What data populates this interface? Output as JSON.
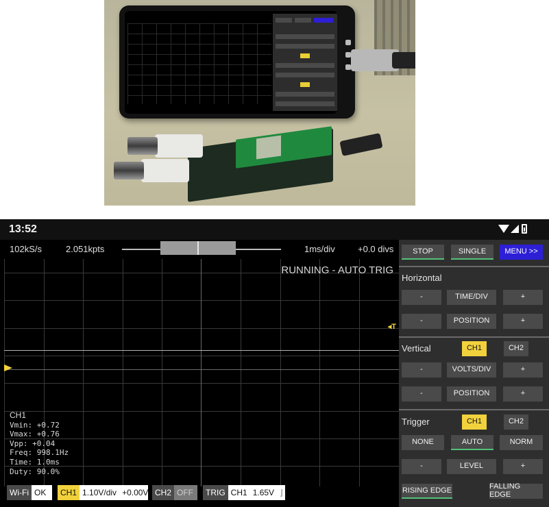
{
  "status_bar": {
    "time": "13:52"
  },
  "scope": {
    "sample_rate": "102kS/s",
    "points": "2.051kpts",
    "timebase": "1ms/div",
    "offset": "+0.0 divs",
    "run_state": "RUNNING - AUTO TRIG",
    "trigger_marker": "◂T",
    "measurements": {
      "channel": "CH1",
      "lines": [
        "Vmin: +0.72",
        "Vmax: +0.76",
        "Vpp: +0.04",
        "Freq: 998.1Hz",
        "Time: 1.0ms",
        "Duty: 90.0%"
      ]
    },
    "bottom_bar": {
      "wifi_tag": "Wi-Fi",
      "wifi_val": "OK",
      "ch1_tag": "CH1",
      "ch1_scale": "1.10V/div",
      "ch1_offset": "+0.00V",
      "ch2_tag": "CH2",
      "ch2_val": "OFF",
      "trig_tag": "TRIG",
      "trig_src": "CH1",
      "trig_level": "1.65V",
      "trig_edge": "⌋"
    }
  },
  "panel": {
    "stop": "STOP",
    "single": "SINGLE",
    "menu": "MENU >>",
    "horizontal": {
      "title": "Horizontal",
      "minus": "-",
      "time_div": "TIME/DIV",
      "plus": "+",
      "position": "POSITION"
    },
    "vertical": {
      "title": "Vertical",
      "ch1": "CH1",
      "ch2": "CH2",
      "minus": "-",
      "volts_div": "VOLTS/DIV",
      "plus": "+",
      "position": "POSITION"
    },
    "trigger": {
      "title": "Trigger",
      "ch1": "CH1",
      "ch2": "CH2",
      "none": "NONE",
      "auto": "AUTO",
      "norm": "NORM",
      "minus": "-",
      "level": "LEVEL",
      "plus": "+",
      "rising": "RISING EDGE",
      "falling": "FALLING EDGE"
    }
  },
  "colors": {
    "accent_yellow": "#f2d23c",
    "menu_blue": "#2d1fd6",
    "selected_green": "#53c27a"
  }
}
